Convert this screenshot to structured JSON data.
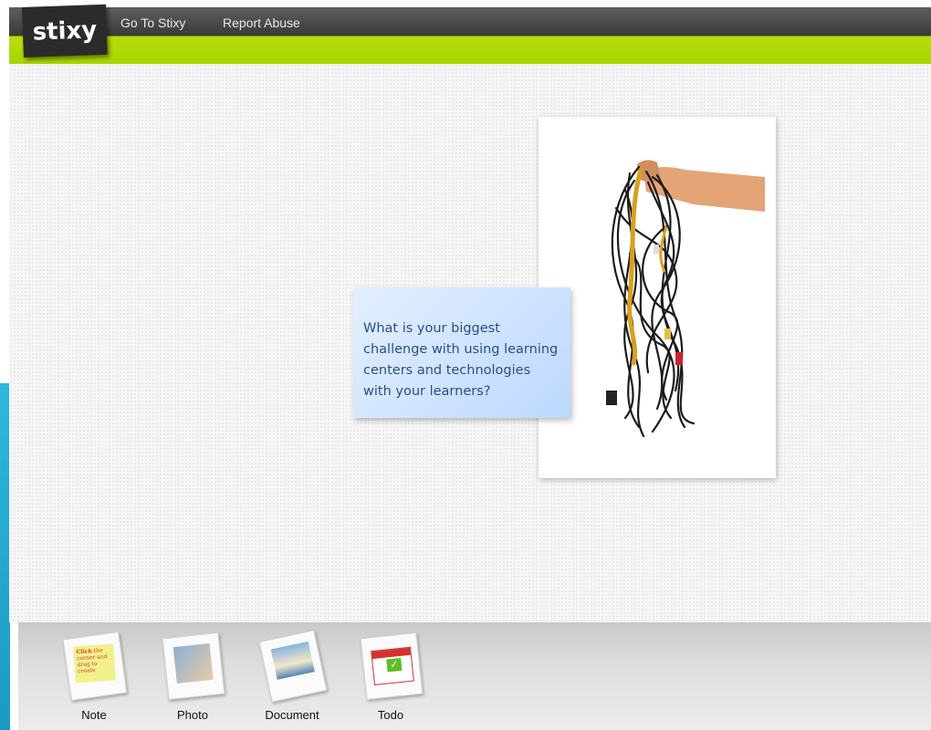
{
  "header": {
    "logo": "stixy",
    "nav": [
      {
        "label": "Go To Stixy"
      },
      {
        "label": "Report Abuse"
      }
    ]
  },
  "board": {
    "note_text": "What is your biggest\nchallenge with using learning\ncenters and technologies\nwith your learners?",
    "photo_subject": "tangled-cables-photo"
  },
  "dock": {
    "items": [
      {
        "label": "Note",
        "icon": "sticky-note-icon"
      },
      {
        "label": "Photo",
        "icon": "photo-icon"
      },
      {
        "label": "Document",
        "icon": "document-icon"
      },
      {
        "label": "Todo",
        "icon": "todo-calendar-icon"
      }
    ]
  },
  "colors": {
    "header_dark": "#3a3a3a",
    "header_green": "#a8d400",
    "note_blue": "#cfe3ff",
    "note_text": "#2a4f8a"
  }
}
